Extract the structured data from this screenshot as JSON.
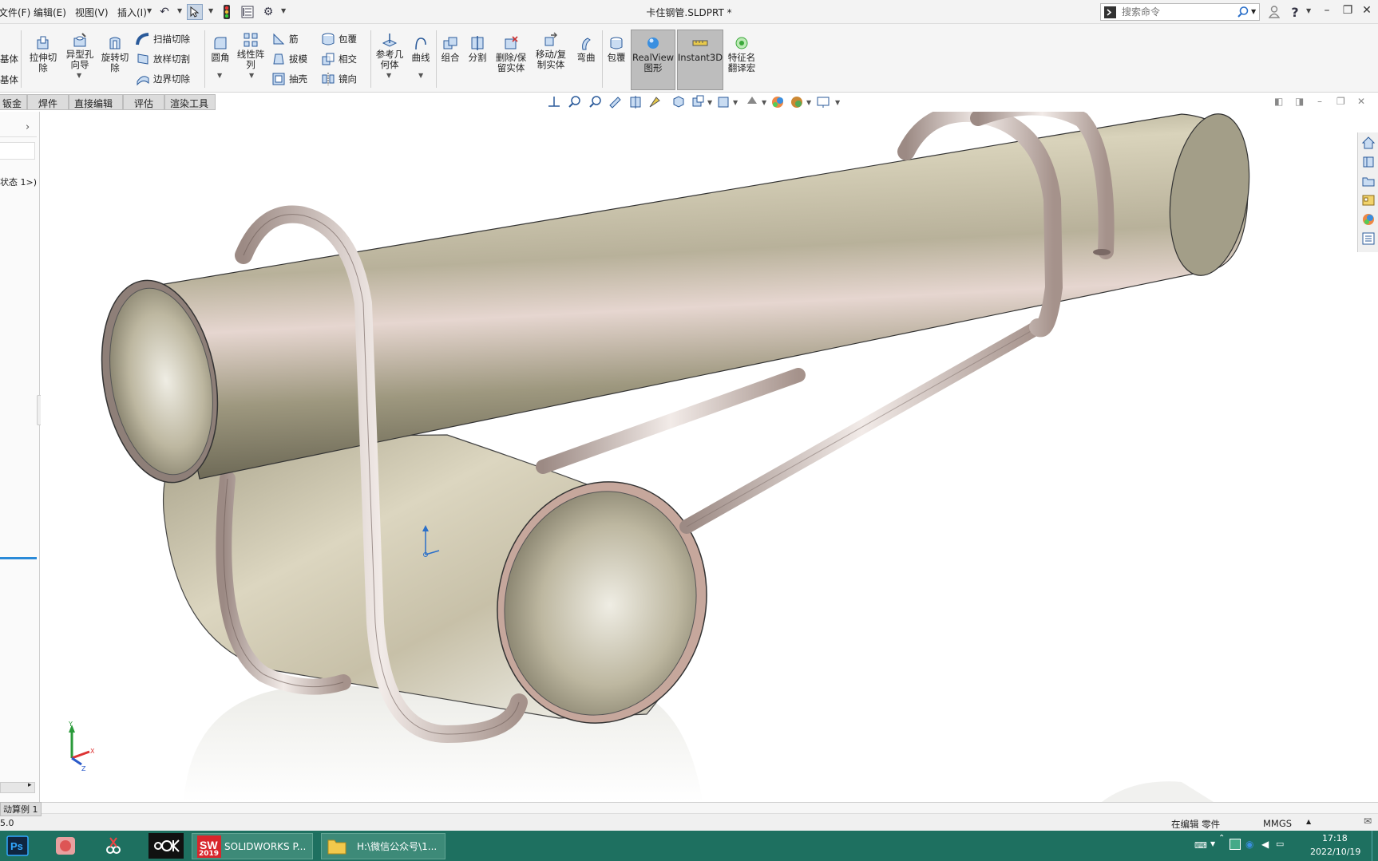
{
  "menubar": {
    "file": "文件(F)",
    "edit": "编辑(E)",
    "view": "视图(V)",
    "insert": "插入(I)",
    "doc_title": "卡住钢管.SLDPRT *",
    "search_placeholder": "搜索命令"
  },
  "ribbon": {
    "left_partial_1": "基体",
    "left_partial_2": "基体",
    "extrude_cut": "拉伸切除",
    "hole_wizard": "异型孔向导",
    "revolve_cut": "旋转切除",
    "sweep_cut": "扫描切除",
    "loft_cut": "放样切割",
    "boundary_cut": "边界切除",
    "fillet": "圆角",
    "linear_pattern": "线性阵列",
    "rib": "筋",
    "draft": "拔模",
    "shell": "抽壳",
    "wrap": "包覆",
    "intersect": "相交",
    "mirror": "镜向",
    "ref_geometry": "参考几何体",
    "curves": "曲线",
    "combine": "组合",
    "split": "分割",
    "delete_keep_body": "删除/保留实体",
    "move_copy_body": "移动/复制实体",
    "flex": "弯曲",
    "wrap2": "包覆",
    "realview": "RealView图形",
    "instant3d": "Instant3D",
    "feature_translator": "特征名翻译宏"
  },
  "tabs": [
    "钣金",
    "焊件",
    "直接编辑",
    "评估",
    "渲染工具"
  ],
  "left_panel": {
    "config_text": "状态 1>)",
    "bottom_tab": "动算例 1",
    "value": "5.0"
  },
  "status": {
    "editing": "在编辑 零件",
    "units": "MMGS"
  },
  "taskbar": {
    "solidworks_task": "SOLIDWORKS P...",
    "explorer_task": "H:\\微信公众号\\1...",
    "sw_badge": "2019",
    "time": "17:18",
    "date": "2022/10/19"
  },
  "colors": {
    "taskbar": "#1e7060",
    "pipe_light": "#e6e1cc",
    "pipe_dark": "#8f8a72",
    "wire": "#d9c8c0",
    "accent_blue": "#2a6fc9"
  }
}
